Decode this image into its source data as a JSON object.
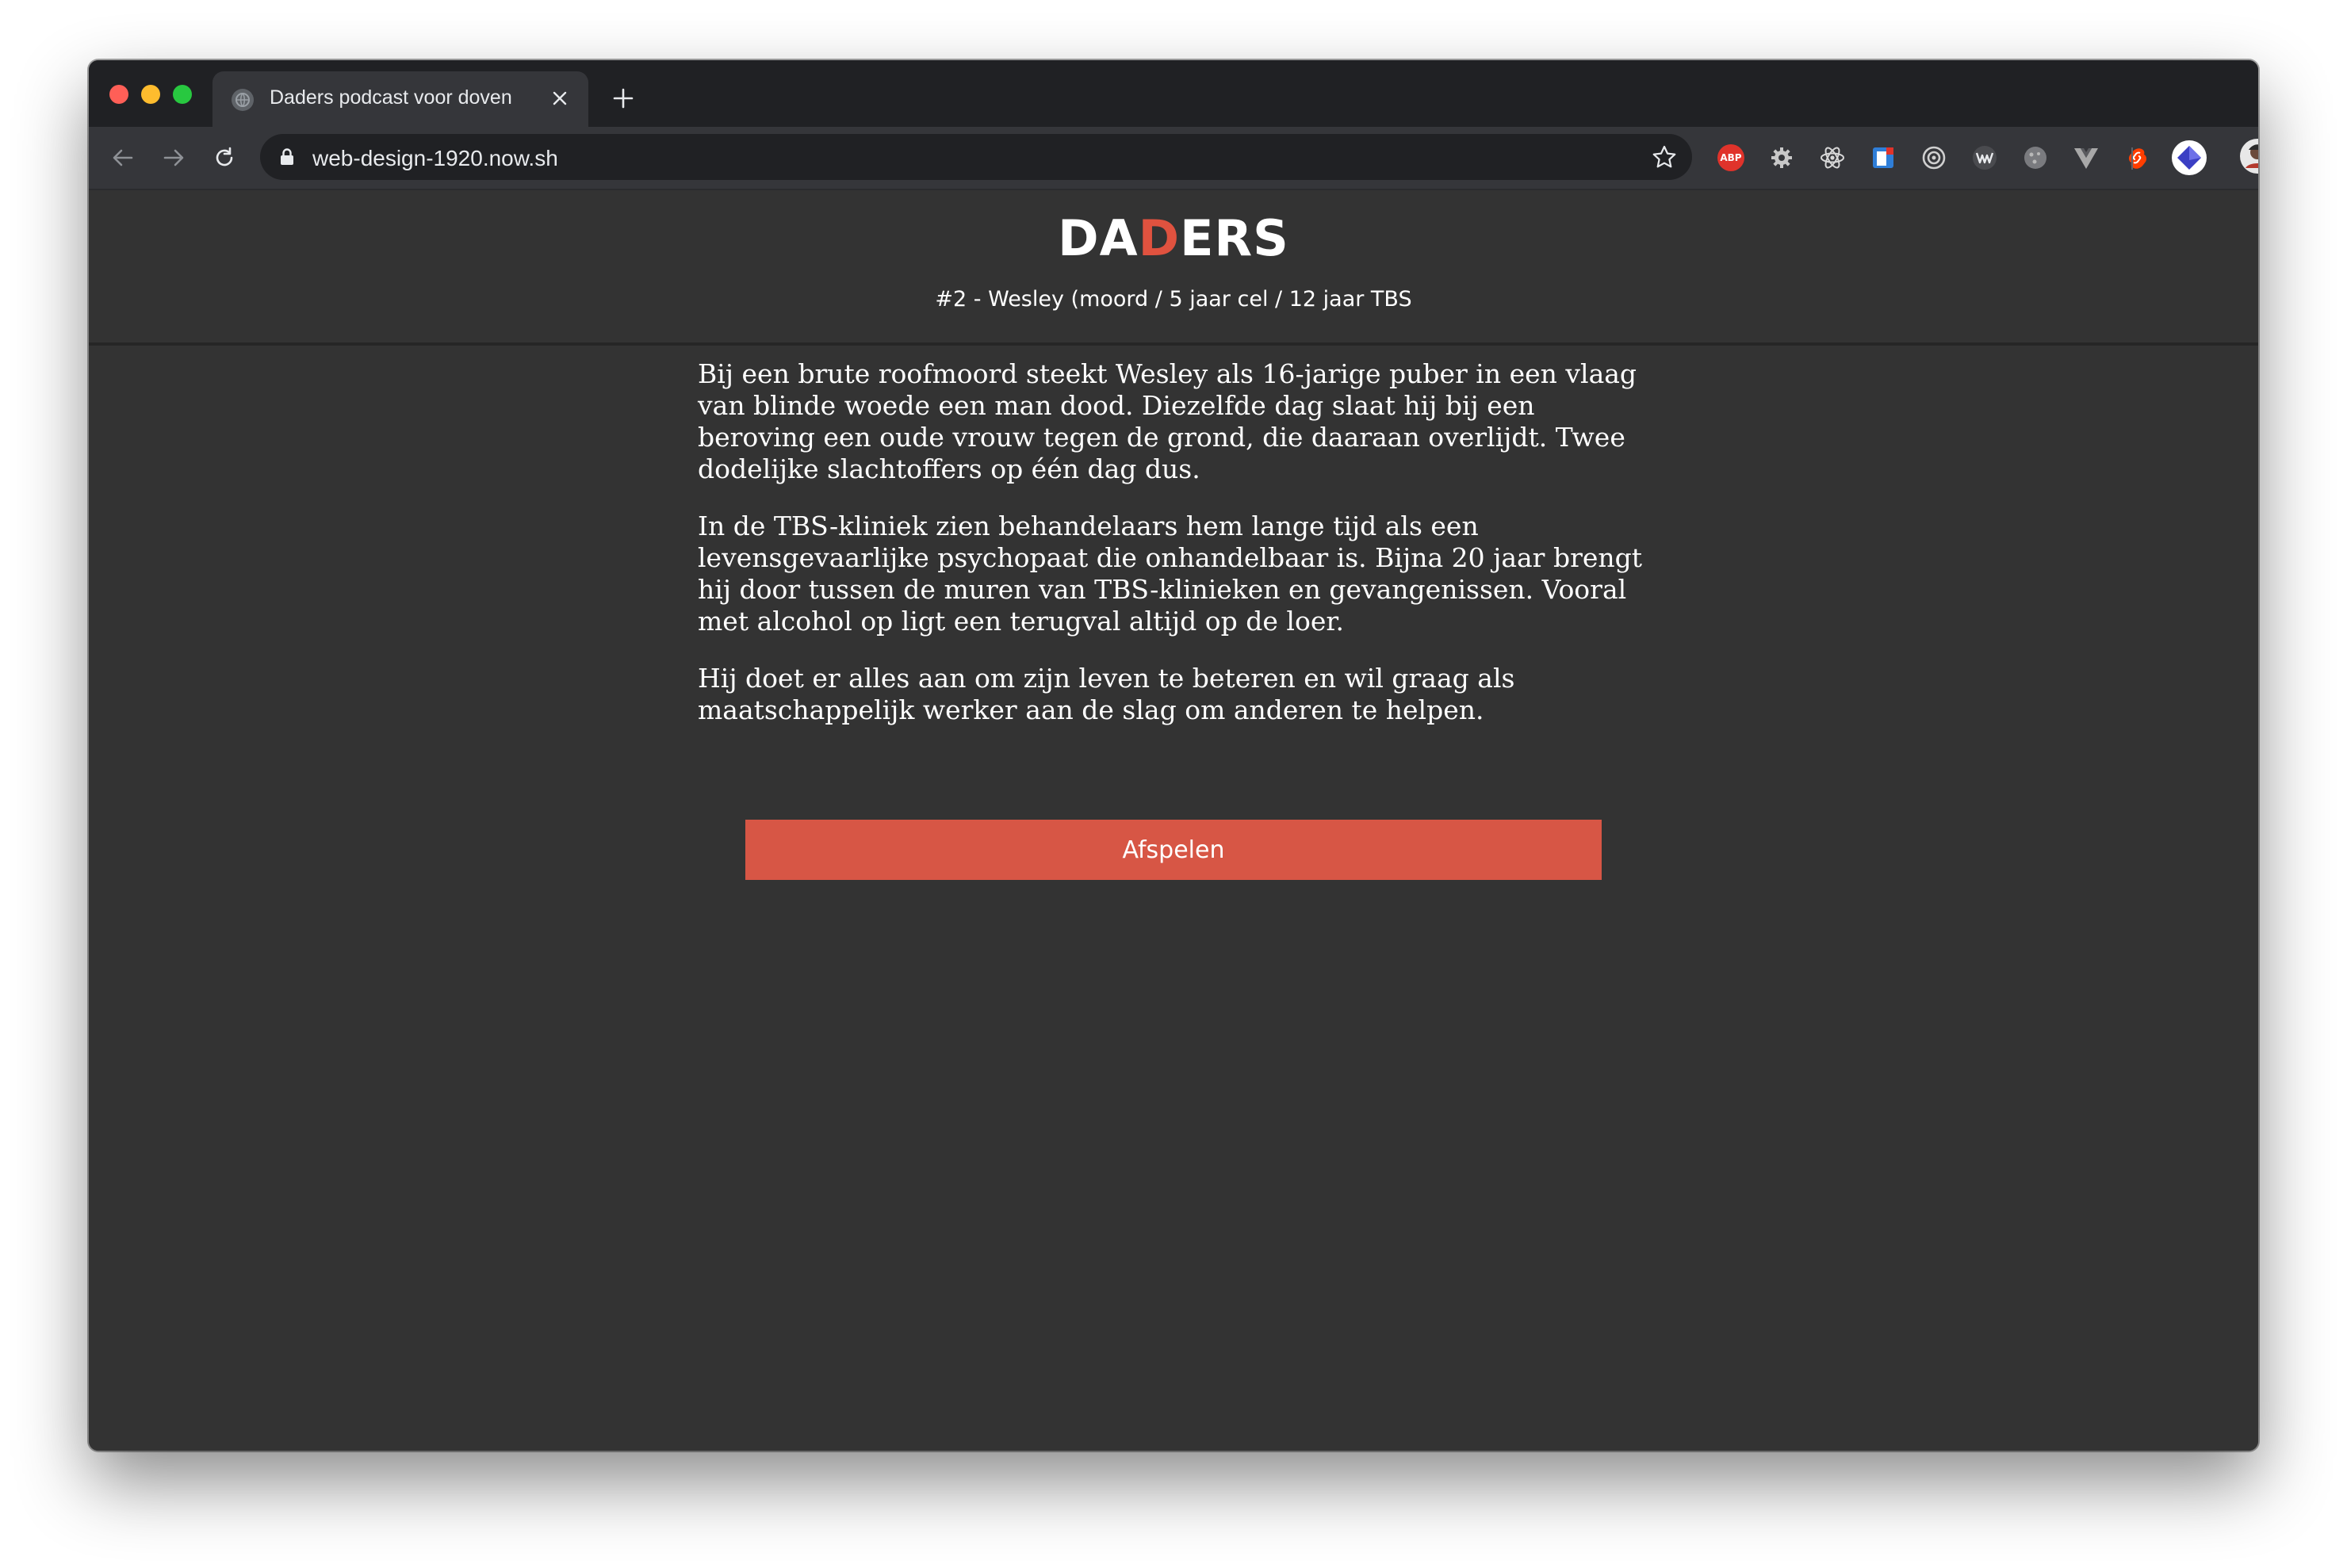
{
  "browser": {
    "tab": {
      "title": "Daders podcast voor doven",
      "favicon": "globe-icon",
      "close": "×"
    },
    "new_tab": "+",
    "url": "web-design-1920.now.sh",
    "extensions": [
      "adblock-plus-icon",
      "gear-extension-icon",
      "react-devtools-icon",
      "extension-square-icon",
      "target-extension-icon",
      "w-extension-icon",
      "circle-extension-icon",
      "vue-devtools-icon",
      "svelte-devtools-icon",
      "diamond-extension-icon"
    ],
    "adblock_label": "ABP"
  },
  "page": {
    "logo": {
      "part1": "DA",
      "accent": "D",
      "part2": "ERS",
      "accent_color": "#e0523f"
    },
    "episode": "#2 - Wesley (moord / 5 jaar cel / 12 jaar TBS",
    "paragraphs": [
      "Bij een brute roofmoord steekt Wesley als 16-jarige puber in een vlaag van blinde woede een man dood. Diezelfde dag slaat hij bij een beroving een oude vrouw tegen de grond, die daaraan overlijdt. Twee dodelijke slachtoffers op één dag dus.",
      "In de TBS-kliniek zien behandelaars hem lange tijd als een levensgevaarlijke psychopaat die onhandelbaar is. Bijna 20 jaar brengt hij door tussen de muren van TBS-klinieken en gevangenissen. Vooral met alcohol op ligt een terugval altijd op de loer.",
      "Hij doet er alles aan om zijn leven te beteren en wil graag als maatschappelijk werker aan de slag om anderen te helpen."
    ],
    "play_button": "Afspelen",
    "button_color": "#d75645"
  }
}
